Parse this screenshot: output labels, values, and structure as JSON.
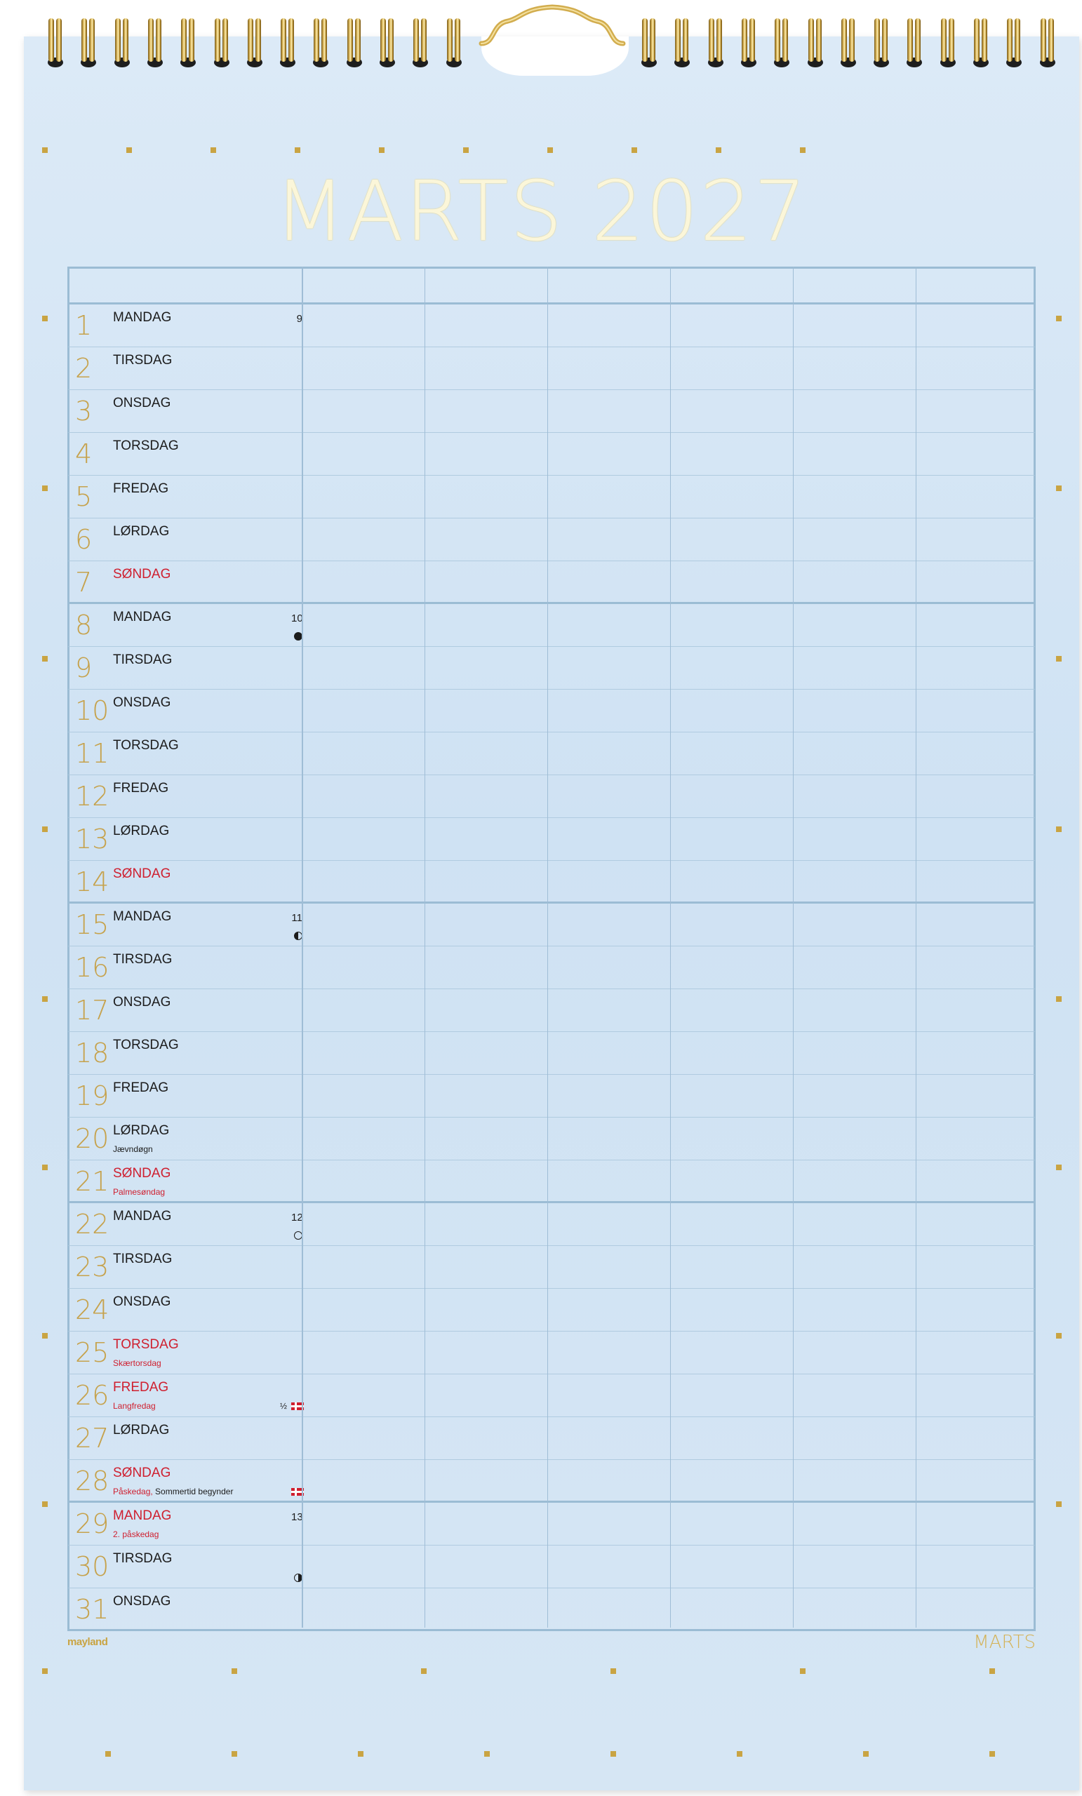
{
  "calendar": {
    "title": "MARTS 2027",
    "footer_month": "MARTS",
    "brand": "mayland",
    "columns": 6,
    "days": [
      {
        "num": "1",
        "name": "MANDAG",
        "red": false,
        "week": "9",
        "moon": "",
        "note": "",
        "note_red": "",
        "flag": false,
        "half": ""
      },
      {
        "num": "2",
        "name": "TIRSDAG",
        "red": false,
        "week": "",
        "moon": "",
        "note": "",
        "note_red": "",
        "flag": false,
        "half": ""
      },
      {
        "num": "3",
        "name": "ONSDAG",
        "red": false,
        "week": "",
        "moon": "",
        "note": "",
        "note_red": "",
        "flag": false,
        "half": ""
      },
      {
        "num": "4",
        "name": "TORSDAG",
        "red": false,
        "week": "",
        "moon": "",
        "note": "",
        "note_red": "",
        "flag": false,
        "half": ""
      },
      {
        "num": "5",
        "name": "FREDAG",
        "red": false,
        "week": "",
        "moon": "",
        "note": "",
        "note_red": "",
        "flag": false,
        "half": ""
      },
      {
        "num": "6",
        "name": "LØRDAG",
        "red": false,
        "week": "",
        "moon": "",
        "note": "",
        "note_red": "",
        "flag": false,
        "half": ""
      },
      {
        "num": "7",
        "name": "SØNDAG",
        "red": true,
        "week": "",
        "moon": "",
        "note": "",
        "note_red": "",
        "flag": false,
        "half": ""
      },
      {
        "num": "8",
        "name": "MANDAG",
        "red": false,
        "week": "10",
        "moon": "full",
        "note": "",
        "note_red": "",
        "flag": false,
        "half": ""
      },
      {
        "num": "9",
        "name": "TIRSDAG",
        "red": false,
        "week": "",
        "moon": "",
        "note": "",
        "note_red": "",
        "flag": false,
        "half": ""
      },
      {
        "num": "10",
        "name": "ONSDAG",
        "red": false,
        "week": "",
        "moon": "",
        "note": "",
        "note_red": "",
        "flag": false,
        "half": ""
      },
      {
        "num": "11",
        "name": "TORSDAG",
        "red": false,
        "week": "",
        "moon": "",
        "note": "",
        "note_red": "",
        "flag": false,
        "half": ""
      },
      {
        "num": "12",
        "name": "FREDAG",
        "red": false,
        "week": "",
        "moon": "",
        "note": "",
        "note_red": "",
        "flag": false,
        "half": ""
      },
      {
        "num": "13",
        "name": "LØRDAG",
        "red": false,
        "week": "",
        "moon": "",
        "note": "",
        "note_red": "",
        "flag": false,
        "half": ""
      },
      {
        "num": "14",
        "name": "SØNDAG",
        "red": true,
        "week": "",
        "moon": "",
        "note": "",
        "note_red": "",
        "flag": false,
        "half": ""
      },
      {
        "num": "15",
        "name": "MANDAG",
        "red": false,
        "week": "11",
        "moon": "half-left",
        "note": "",
        "note_red": "",
        "flag": false,
        "half": ""
      },
      {
        "num": "16",
        "name": "TIRSDAG",
        "red": false,
        "week": "",
        "moon": "",
        "note": "",
        "note_red": "",
        "flag": false,
        "half": ""
      },
      {
        "num": "17",
        "name": "ONSDAG",
        "red": false,
        "week": "",
        "moon": "",
        "note": "",
        "note_red": "",
        "flag": false,
        "half": ""
      },
      {
        "num": "18",
        "name": "TORSDAG",
        "red": false,
        "week": "",
        "moon": "",
        "note": "",
        "note_red": "",
        "flag": false,
        "half": ""
      },
      {
        "num": "19",
        "name": "FREDAG",
        "red": false,
        "week": "",
        "moon": "",
        "note": "",
        "note_red": "",
        "flag": false,
        "half": ""
      },
      {
        "num": "20",
        "name": "LØRDAG",
        "red": false,
        "week": "",
        "moon": "",
        "note": "Jævndøgn",
        "note_red": "",
        "flag": false,
        "half": ""
      },
      {
        "num": "21",
        "name": "SØNDAG",
        "red": true,
        "week": "",
        "moon": "",
        "note": "",
        "note_red": "Palmesøndag",
        "flag": false,
        "half": ""
      },
      {
        "num": "22",
        "name": "MANDAG",
        "red": false,
        "week": "12",
        "moon": "new",
        "note": "",
        "note_red": "",
        "flag": false,
        "half": ""
      },
      {
        "num": "23",
        "name": "TIRSDAG",
        "red": false,
        "week": "",
        "moon": "",
        "note": "",
        "note_red": "",
        "flag": false,
        "half": ""
      },
      {
        "num": "24",
        "name": "ONSDAG",
        "red": false,
        "week": "",
        "moon": "",
        "note": "",
        "note_red": "",
        "flag": false,
        "half": ""
      },
      {
        "num": "25",
        "name": "TORSDAG",
        "red": true,
        "week": "",
        "moon": "",
        "note": "",
        "note_red": "Skærtorsdag",
        "flag": false,
        "half": ""
      },
      {
        "num": "26",
        "name": "FREDAG",
        "red": true,
        "week": "",
        "moon": "",
        "note": "",
        "note_red": "Langfredag",
        "flag": true,
        "half": "½"
      },
      {
        "num": "27",
        "name": "LØRDAG",
        "red": false,
        "week": "",
        "moon": "",
        "note": "",
        "note_red": "",
        "flag": false,
        "half": ""
      },
      {
        "num": "28",
        "name": "SØNDAG",
        "red": true,
        "week": "",
        "moon": "",
        "note": " Sommertid begynder",
        "note_red": "Påskedag,",
        "flag": true,
        "half": ""
      },
      {
        "num": "29",
        "name": "MANDAG",
        "red": true,
        "week": "13",
        "moon": "",
        "note": "",
        "note_red": "2. påskedag",
        "flag": false,
        "half": ""
      },
      {
        "num": "30",
        "name": "TIRSDAG",
        "red": false,
        "week": "",
        "moon": "half-right",
        "note": "",
        "note_red": "",
        "flag": false,
        "half": ""
      },
      {
        "num": "31",
        "name": "ONSDAG",
        "red": false,
        "week": "",
        "moon": "",
        "note": "",
        "note_red": "",
        "flag": false,
        "half": ""
      }
    ]
  },
  "colors": {
    "gold": "#c6a24c",
    "red": "#cf1f2f",
    "grid_line": "#9bbcd4",
    "paper": "#d4e5f4"
  }
}
